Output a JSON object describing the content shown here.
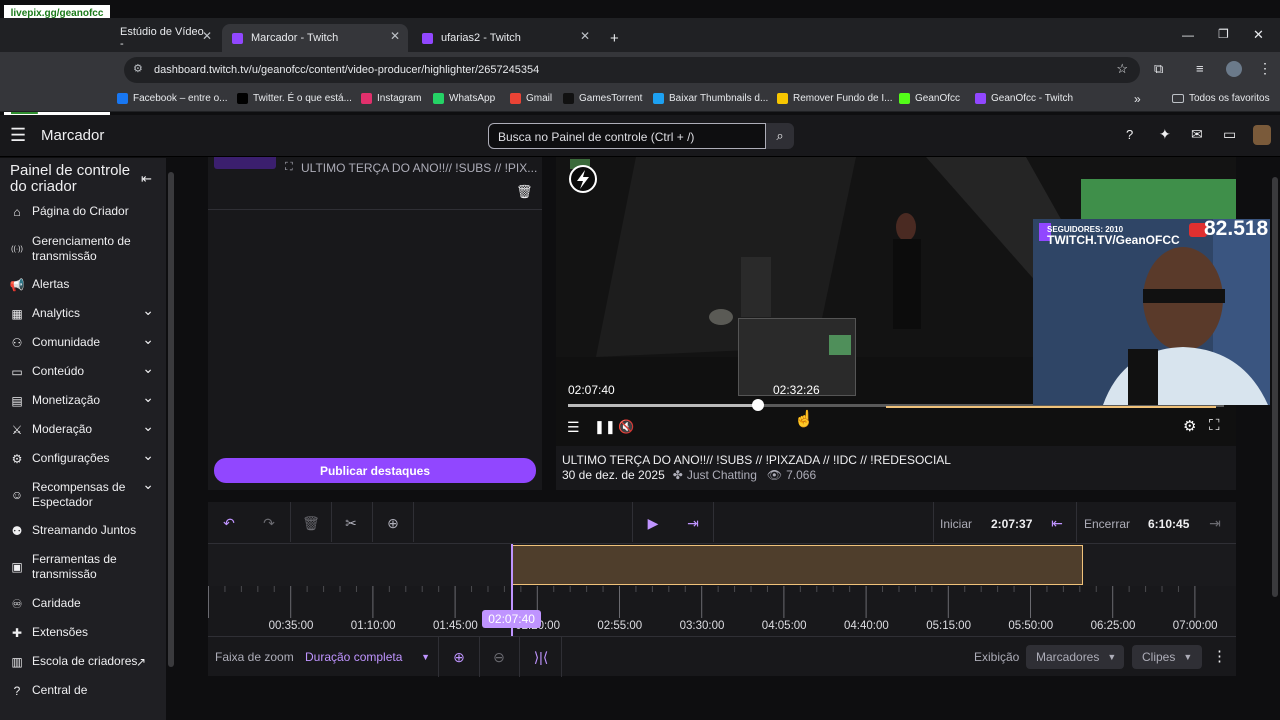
{
  "browser": {
    "tabs": [
      {
        "label": "Estúdio de Vídeo -",
        "active": false
      },
      {
        "label": "Marcador - Twitch",
        "active": true
      },
      {
        "label": "ufarias2 - Twitch",
        "active": false
      }
    ],
    "new_tab": "+",
    "url": "dashboard.twitch.tv/u/geanofcc/content/video-producer/highlighter/2657245354",
    "bookmarks": [
      {
        "label": "Facebook – entre o...",
        "color": "#1877f2"
      },
      {
        "label": "Twitter. É o que está...",
        "color": "#000000"
      },
      {
        "label": "Instagram",
        "color": "#e1306c"
      },
      {
        "label": "WhatsApp",
        "color": "#25d366"
      },
      {
        "label": "Gmail",
        "color": "#ea4335"
      },
      {
        "label": "GamesTorrent",
        "color": "#111111"
      },
      {
        "label": "Baixar Thumbnails d...",
        "color": "#1da1f2"
      },
      {
        "label": "Remover Fundo de I...",
        "color": "#f7c600"
      },
      {
        "label": "GeanOfcc",
        "color": "#53fc18"
      },
      {
        "label": "GeanOfcc - Twitch",
        "color": "#9147ff"
      }
    ],
    "bookmarks_more": "»",
    "all_favorites": "Todos os favoritos"
  },
  "overlay": {
    "qr_caption": "livepix.gg/geanofcc",
    "followers": "SEGUIDORES: 2010",
    "channel": "TWITCH.TV/GeanOFCC",
    "subs_count": "82.518"
  },
  "topbar": {
    "title": "Marcador",
    "search_placeholder": "Busca no Painel de controle (Ctrl + /)"
  },
  "sidebar": {
    "heading": "Painel de controle do criador",
    "items": [
      {
        "label": "Página do Criador",
        "icon": "home-icon",
        "expandable": false
      },
      {
        "label": "Gerenciamento de transmissão",
        "icon": "broadcast-icon",
        "expandable": false
      },
      {
        "label": "Alertas",
        "icon": "megaphone-icon",
        "expandable": false
      },
      {
        "label": "Analytics",
        "icon": "analytics-icon",
        "expandable": true
      },
      {
        "label": "Comunidade",
        "icon": "community-icon",
        "expandable": true
      },
      {
        "label": "Conteúdo",
        "icon": "content-icon",
        "expandable": true
      },
      {
        "label": "Monetização",
        "icon": "money-icon",
        "expandable": true
      },
      {
        "label": "Moderação",
        "icon": "sword-icon",
        "expandable": true
      },
      {
        "label": "Configurações",
        "icon": "gear-icon",
        "expandable": true
      },
      {
        "label": "Recompensas de Espectador",
        "icon": "smile-icon",
        "expandable": true
      },
      {
        "label": "Streamando Juntos",
        "icon": "together-icon",
        "expandable": false
      },
      {
        "label": "Ferramentas de transmissão",
        "icon": "camera-icon",
        "expandable": false
      },
      {
        "label": "Caridade",
        "icon": "ribbon-icon",
        "expandable": false
      },
      {
        "label": "Extensões",
        "icon": "puzzle-icon",
        "expandable": false
      },
      {
        "label": "Escola de criadores",
        "icon": "book-icon",
        "expandable": false
      },
      {
        "label": "Central de",
        "icon": "help-icon",
        "expandable": false
      }
    ]
  },
  "highlight_list": {
    "item_title": "ULTIMO TERÇA DO ANO!!// !SUBS // !PIX...",
    "publish_label": "Publicar destaques"
  },
  "player": {
    "current_time": "02:07:40",
    "hover_time": "02:32:26",
    "progress": 0.29,
    "title": "ULTIMO TERÇA DO ANO!!// !SUBS // !PIXZADA // !IDC // !REDESOCIAL",
    "date": "30 de dez. de 2025",
    "category": "Just Chatting",
    "views": "7.066"
  },
  "editor": {
    "start_label": "Iniciar",
    "start_value": "2:07:37",
    "end_label": "Encerrar",
    "end_value": "6:10:45",
    "playhead_time": "02:07:40",
    "clip_start": 0.295,
    "clip_end": 0.851,
    "ticks": [
      "00:35:00",
      "01:10:00",
      "01:45:00",
      "02:20:00",
      "02:55:00",
      "03:30:00",
      "04:05:00",
      "04:40:00",
      "05:15:00",
      "05:50:00",
      "06:25:00",
      "07:00:00"
    ],
    "zoom_label": "Faixa de zoom",
    "zoom_value": "Duração completa",
    "display_label": "Exibição",
    "markers_label": "Marcadores",
    "clips_label": "Clipes"
  }
}
